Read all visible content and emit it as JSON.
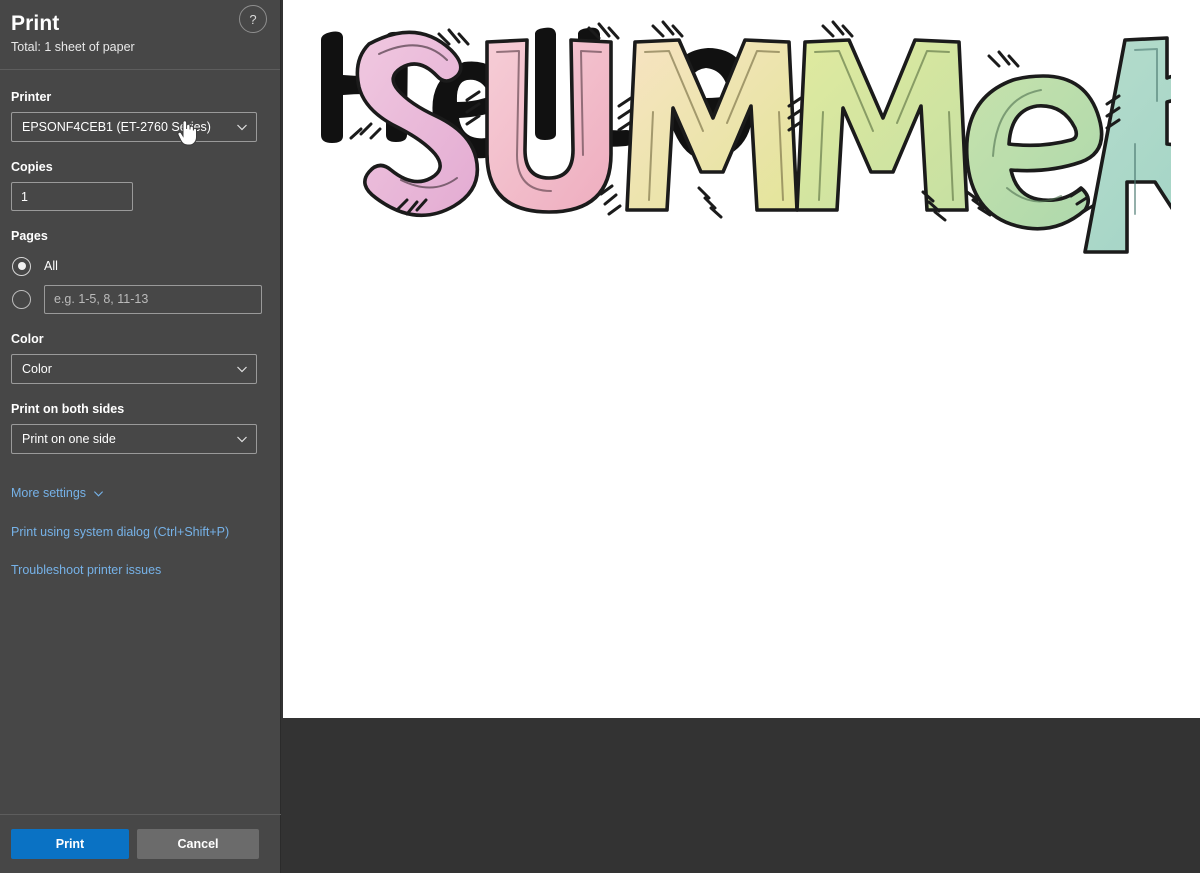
{
  "panel": {
    "title": "Print",
    "subtitle": "Total: 1 sheet of paper",
    "help_label": "?",
    "printer": {
      "label": "Printer",
      "selected": "EPSONF4CEB1 (ET-2760 Series)"
    },
    "copies": {
      "label": "Copies",
      "value": "1"
    },
    "pages": {
      "label": "Pages",
      "all_label": "All",
      "all_selected": true,
      "custom_selected": false,
      "custom_placeholder": "e.g. 1-5, 8, 11-13",
      "custom_value": ""
    },
    "color": {
      "label": "Color",
      "selected": "Color"
    },
    "both_sides": {
      "label": "Print on both sides",
      "selected": "Print on one side"
    },
    "more_settings_label": "More settings",
    "system_dialog_link": "Print using system dialog (Ctrl+Shift+P)",
    "troubleshoot_link": "Troubleshoot printer issues",
    "print_button": "Print",
    "cancel_button": "Cancel",
    "colors": {
      "panel_bg": "#474747",
      "preview_bg": "#333333",
      "page_bg": "#ffffff",
      "accent_blue": "#0a72c4",
      "link_blue": "#76b2e8",
      "secondary_button": "#6b6b6b",
      "border": "#9a9a9a"
    }
  },
  "preview": {
    "artwork": {
      "line1_text": "Hello",
      "line2_text": "SUMMER",
      "line1_color": "#111111",
      "line2_letters": [
        {
          "char": "S",
          "fill": "#eab8d6"
        },
        {
          "char": "U",
          "fill": "#f0b9c6"
        },
        {
          "char": "M",
          "fill": "#f3ddb4"
        },
        {
          "char": "M",
          "fill": "#ddeaa0"
        },
        {
          "char": "E",
          "fill": "#bfdfa8"
        },
        {
          "char": "R",
          "fill": "#a8d8c8"
        }
      ],
      "outline_color": "#1b1b1b"
    }
  }
}
